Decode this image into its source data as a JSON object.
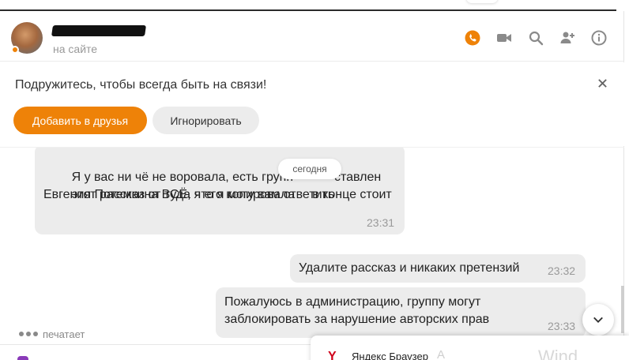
{
  "contact": {
    "name": "███████",
    "status": "на сайте"
  },
  "header_icons": [
    "phone-icon",
    "video-icon",
    "search-icon",
    "add-user-icon",
    "info-icon"
  ],
  "colors": {
    "accent": "#ee8208",
    "bubble": "#ececec",
    "muted": "#999999"
  },
  "banner": {
    "text": "Подружитесь, чтобы всегда быть на связи!",
    "add_label": "Добавить в друзья",
    "ignore_label": "Игнорировать"
  },
  "date_badge": "сегодня",
  "messages": [
    {
      "line1": "Я у вас ни чё не воровала, есть групп",
      "line1_tail": "ставлен",
      "line2": "этот рассказ от туда я его копировала",
      "line2_tail": "в конце стоит",
      "line3": "Евгения Потемкина ВСЁ, что я могу вам ответить",
      "time": "23:31"
    },
    {
      "text": "Удалите рассказ и никаких претензий",
      "time": "23:32"
    },
    {
      "line1": "Пожалуюсь в администрацию, группу могут",
      "line2": "заблокировать за нарушение авторских прав",
      "time": "23:33"
    }
  ],
  "typing": "печатает",
  "toast": {
    "title": "Яндекс Браузер",
    "ghost1": "А",
    "ghost2": "Wind"
  }
}
